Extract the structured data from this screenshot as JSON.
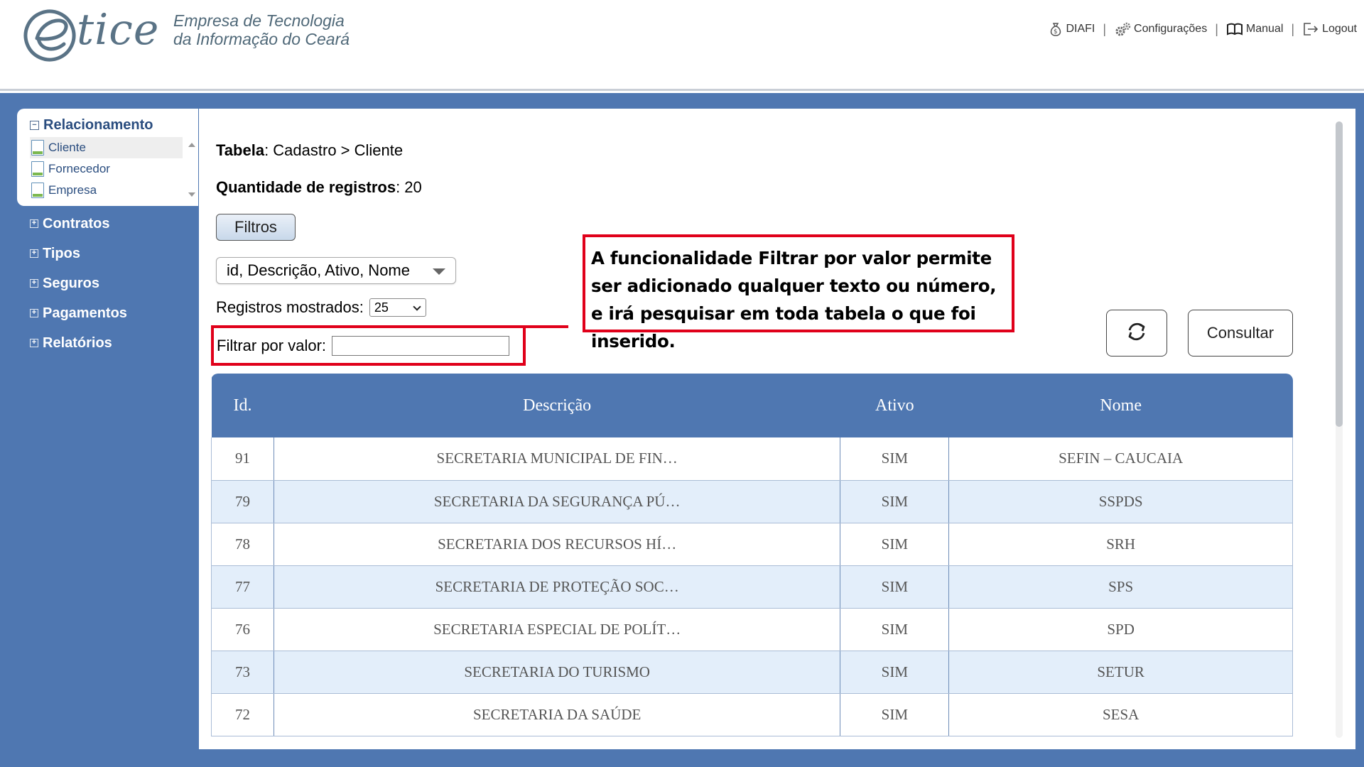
{
  "header": {
    "logo_text": "tice",
    "tagline_line1": "Empresa de Tecnologia",
    "tagline_line2": "da Informação do Ceará",
    "nav": [
      {
        "label": "DIAFI",
        "icon": "money-bag-icon"
      },
      {
        "label": "Configurações",
        "icon": "gears-icon"
      },
      {
        "label": "Manual",
        "icon": "book-icon"
      },
      {
        "label": "Logout",
        "icon": "logout-icon"
      }
    ],
    "separator": "|"
  },
  "sidebar": {
    "open_section": {
      "label": "Relacionamento",
      "toggle": "−",
      "items": [
        "Cliente",
        "Fornecedor",
        "Empresa"
      ],
      "active_item": "Cliente"
    },
    "closed_sections": [
      "Contratos",
      "Tipos",
      "Seguros",
      "Pagamentos",
      "Relatórios"
    ],
    "closed_toggle": "+"
  },
  "main": {
    "tabela_label": "Tabela",
    "tabela_value": ": Cadastro > Cliente",
    "qtd_label": "Quantidade de registros",
    "qtd_value": ": 20",
    "filtros_button": "Filtros",
    "columns_select": "id, Descrição, Ativo, Nome",
    "registros_label": "Registros mostrados:",
    "registros_value": "25",
    "filtrar_label": "Filtrar por valor:",
    "filtrar_value": "",
    "consultar_button": "Consultar",
    "callout_text": "A funcionalidade Filtrar por valor permite ser adicionado qualquer texto ou número, e irá pesquisar em toda tabela o que foi inserido."
  },
  "table": {
    "headers": [
      "Id.",
      "Descrição",
      "Ativo",
      "Nome"
    ],
    "rows": [
      [
        "91",
        "SECRETARIA MUNICIPAL DE FIN…",
        "SIM",
        "SEFIN – CAUCAIA"
      ],
      [
        "79",
        "SECRETARIA DA SEGURANÇA PÚ…",
        "SIM",
        "SSPDS"
      ],
      [
        "78",
        "SECRETARIA DOS RECURSOS HÍ…",
        "SIM",
        "SRH"
      ],
      [
        "77",
        "SECRETARIA DE PROTEÇÃO SOC…",
        "SIM",
        "SPS"
      ],
      [
        "76",
        "SECRETARIA ESPECIAL DE POLÍT…",
        "SIM",
        "SPD"
      ],
      [
        "73",
        "SECRETARIA DO TURISMO",
        "SIM",
        "SETUR"
      ],
      [
        "72",
        "SECRETARIA DA SAÚDE",
        "SIM",
        "SESA"
      ]
    ]
  },
  "colors": {
    "frame_blue": "#4f77b1",
    "highlight_red": "#e0001a",
    "row_alt": "#e3eefa",
    "link_blue": "#2a4d7f"
  }
}
